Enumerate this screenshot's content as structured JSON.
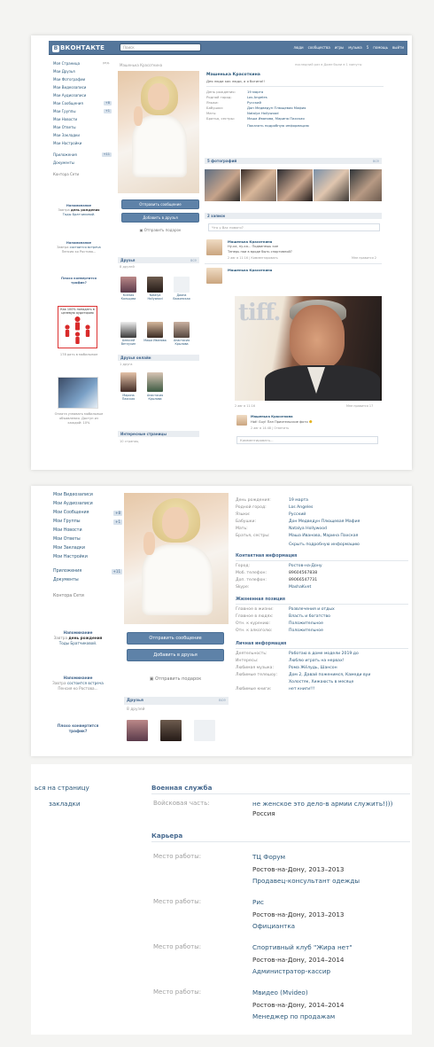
{
  "header": {
    "logo": "ВКОНТАКТЕ",
    "logo_mark": "В",
    "search_placeholder": "Поиск",
    "links": [
      "люди",
      "сообщества",
      "игры",
      "музыка",
      "5",
      "помощь",
      "выйти"
    ]
  },
  "menu": {
    "items": [
      {
        "label": "Моя Страница",
        "badge": "ред."
      },
      {
        "label": "Мои Друзья",
        "badge": ""
      },
      {
        "label": "Мои Фотографии",
        "badge": ""
      },
      {
        "label": "Мои Видеозаписи",
        "badge": ""
      },
      {
        "label": "Мои Аудиозаписи",
        "badge": ""
      },
      {
        "label": "Мои Сообщения",
        "badge": "+8"
      },
      {
        "label": "Мои Группы",
        "badge": "+1"
      },
      {
        "label": "Мои Новости",
        "badge": ""
      },
      {
        "label": "Мои Ответы",
        "badge": ""
      },
      {
        "label": "Мои Закладки",
        "badge": ""
      },
      {
        "label": "Мои Настройки",
        "badge": ""
      },
      {
        "label": "Приложения",
        "badge": "+11"
      },
      {
        "label": "Документы",
        "badge": ""
      }
    ],
    "contacts": "Контора Сети"
  },
  "menu2": {
    "items": [
      {
        "label": "Мои Видеозаписи",
        "badge": ""
      },
      {
        "label": "Мои Аудиозаписи",
        "badge": ""
      },
      {
        "label": "Мои Сообщения",
        "badge": "+8"
      },
      {
        "label": "Мои Группы",
        "badge": "+1"
      },
      {
        "label": "Мои Новости",
        "badge": ""
      },
      {
        "label": "Мои Ответы",
        "badge": ""
      },
      {
        "label": "Мои Закладки",
        "badge": ""
      },
      {
        "label": "Мои Настройки",
        "badge": ""
      },
      {
        "label": "Приложения",
        "badge": "+11"
      },
      {
        "label": "Документы",
        "badge": ""
      }
    ],
    "contacts": "Контора Сети"
  },
  "reminders": {
    "title": "Напоминание",
    "r1_pre": "Завтра",
    "r1_bold": "день рождения",
    "r1_post": "Тоды Братчиковой.",
    "r2_pre": "Завтра",
    "r2_link": "состоится встреча",
    "r2_post": "Пенсия ко Ростова...",
    "traffic": "Плохо конвертится трафик?",
    "ad1_caption": "Как 100% попадать в целевую аудиторию",
    "ad2_caption": "178 рать в мобильном",
    "ad3_caption": "Оплата узнавать мобильные объявления. Доступ из каждой: 10%"
  },
  "profile": {
    "name": "Машенька Красоткина",
    "top_online": "последний раз в Доме были в 1 минуты",
    "status": "Дея люди как люди, а я богиня!!",
    "info": [
      {
        "k": "День рождения:",
        "v": "19 марта"
      },
      {
        "k": "Родной город:",
        "v": "Los Angeles"
      },
      {
        "k": "Языки:",
        "v": "Русский"
      },
      {
        "k": "Бабушки:",
        "v": "Дон Медведун Плющевая Мафия"
      },
      {
        "k": "Мать:",
        "v": "Natalya Hollywood"
      },
      {
        "k": "Братья, сестры:",
        "v": "Маша Иванова, Марина Пахская"
      }
    ],
    "show_more": "Показать подробную информацию",
    "photos_header": "5 фотографий",
    "photos_right": "все",
    "wall_header": "2 записи",
    "wall_placeholder": "Что у Вас нового?",
    "post1_author": "Машенька Красоткина",
    "post1_text1": "Ну-ка, ну-ка... Подвинешь кое",
    "post1_text2": "Теперь пои в вроде быть спортивной?",
    "post1_meta": "2 авг в 11:16 | Комментировать",
    "post1_right": "Мне нравится 2",
    "post2_author": "Машенька Красоткина",
    "post2_meta": "2 авг в 11:16",
    "post2_right": "Мне нравится 17",
    "tiff": "tiff.",
    "comment_author": "Машенька Красоткина",
    "comment_text": "Hot! Guy! Пан Приятельские фото",
    "comment_meta": "2 авг в 14:48 | Ответить",
    "comment_placeholder": "Комментировать..."
  },
  "side_actions": {
    "send_message": "Отправить сообщение",
    "add_friend": "Добавить в друзья",
    "send_gift": "Отправить подарок"
  },
  "friends": {
    "header": "Друзья",
    "header_right": "все",
    "count": "8 друзей",
    "names": [
      "Ксения Кольцова",
      "Natalya Hollywood",
      "Диана Важинская",
      "Алексей Ветлухин",
      "Маша Иванова",
      "Анастасия Крылова"
    ],
    "online_header": "Друзья онлайн",
    "online_count": "1 друга",
    "online_names": [
      "Марина Пахская",
      "Анастасия Крылова"
    ],
    "interesting_header": "Интересные страницы",
    "interesting_count": "10 страниц"
  },
  "profile2": {
    "info": [
      {
        "k": "День рождения:",
        "v": "19 марта"
      },
      {
        "k": "Родной город:",
        "v": "Los Angeles"
      },
      {
        "k": "Языки:",
        "v": "Русский"
      },
      {
        "k": "Бабушки:",
        "v": "Дон Медведун Плющевая Мафия"
      },
      {
        "k": "Мать:",
        "v": "Natalya Hollywood"
      },
      {
        "k": "Братья, сестры:",
        "v": "Маша Иванова, Марина Пахская"
      }
    ],
    "hide_more": "Скрыть подробную информацию",
    "contacts_header": "Контактная информация",
    "contacts": [
      {
        "k": "Город:",
        "v": "Ростов-на-Дону"
      },
      {
        "k": "Моб. телефон:",
        "v": "89604567838"
      },
      {
        "k": "Доп. телефон:",
        "v": "89066547731"
      },
      {
        "k": "Skype:",
        "v": "MashaKvet"
      }
    ],
    "life_header": "Жизненная позиция",
    "life": [
      {
        "k": "Главное в жизни:",
        "v": "Развлечения и отдых"
      },
      {
        "k": "Главное в людях:",
        "v": "Власть и богатство"
      },
      {
        "k": "Отн. к курению:",
        "v": "Положительное"
      },
      {
        "k": "Отн. к алкоголю:",
        "v": "Положительное"
      }
    ],
    "personal_header": "Личная информация",
    "personal": [
      {
        "k": "Деятельность:",
        "v": "Работаю в доме модели 2019 до"
      },
      {
        "k": "Интересы:",
        "v": "Люблю играть на нервах!"
      },
      {
        "k": "Любимая музыка:",
        "v": "Рома Жёлудь, Шансон"
      },
      {
        "k": "Любимые телешоу:",
        "v": "Дом 2, Давай поженимся, Камеди вуи"
      },
      {
        "k": "",
        "v": "Холостяк, Хижаюсть в месяце"
      },
      {
        "k": "Любимые книги:",
        "v": "нет книги!!!"
      }
    ],
    "friends_header": "Друзья",
    "friends_right": "все",
    "friends_count": "8 друзей",
    "traffic": "Плохо конвертится трафик?"
  },
  "details": {
    "left_links": [
      "ься на страницу",
      "закладки"
    ],
    "military_header": "Военная служба",
    "military_key": "Войсковая часть:",
    "military_value": "не женское это дело-в армии служить!)))",
    "military_country": "Россия",
    "career_header": "Карьера",
    "jobs": [
      {
        "k": "Место работы:",
        "place": "ТЦ Форум",
        "city": "Ростов-на-Дону, 2013–2013",
        "role": "Продавец-консультант одежды"
      },
      {
        "k": "Место работы:",
        "place": "Рис",
        "city": "Ростов-на-Дону, 2013–2013",
        "role": "Официантка"
      },
      {
        "k": "Место работы:",
        "place": "Спортивный клуб \"Жира нет\"",
        "city": "Ростов-на-Дону, 2014–2014",
        "role": "Администратор-кассир"
      },
      {
        "k": "Место работы:",
        "place": "Мвидео (Mvideo)",
        "city": "Ростов-на-Дону, 2014–2014",
        "role": "Менеджер по продажам"
      }
    ]
  },
  "colors": {
    "brand": "#54769b",
    "link": "#2b587a",
    "button": "#5e82a8"
  },
  "icons": [
    "gift-icon",
    "smile-icon",
    "people-icon"
  ]
}
